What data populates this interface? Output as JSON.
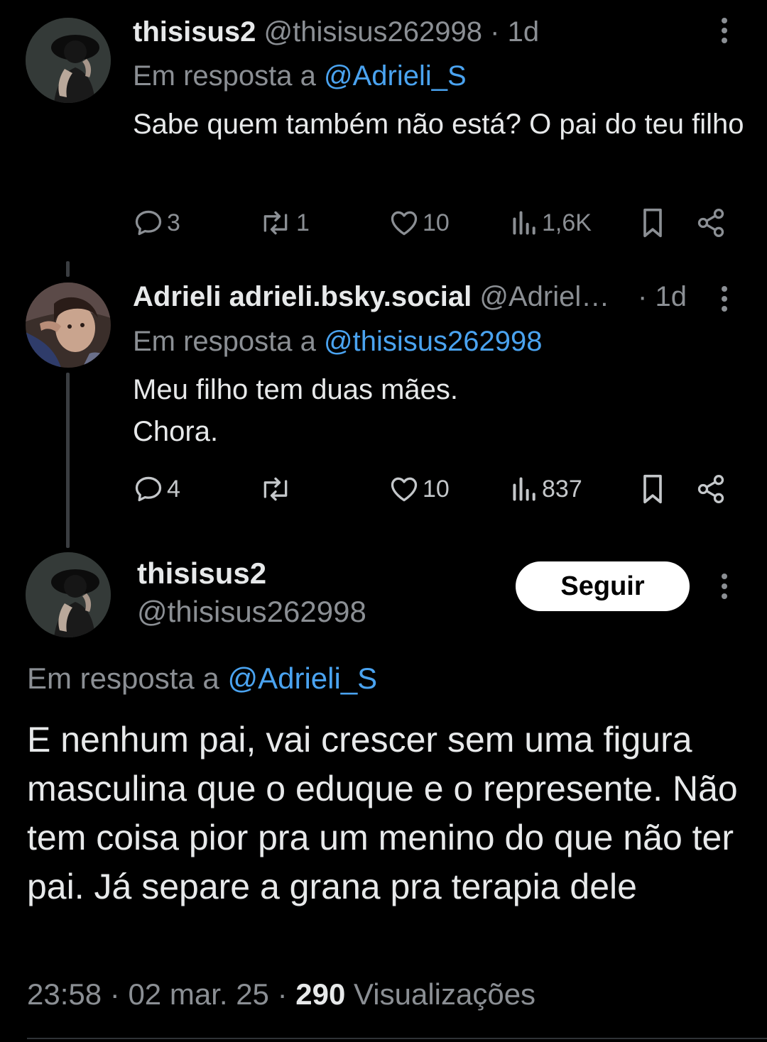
{
  "colors": {
    "background": "#000000",
    "text": "#e7e9ea",
    "muted": "#8b8f94",
    "link": "#4aa3f0",
    "button_bg": "#ffffff"
  },
  "post1": {
    "display_name": "thisisus2",
    "handle": "@thisisus262998",
    "separator": "·",
    "time": "1d",
    "reply_prefix": "Em resposta a",
    "reply_to": "@Adrieli_S",
    "text": "Sabe quem também não está? O pai do teu filho",
    "replies": "3",
    "reposts": "1",
    "likes": "10",
    "views": "1,6K",
    "avatar_icon": "avatar-dark-figure"
  },
  "post2": {
    "display_name": "Adrieli adrieli.bsky.social",
    "handle": "@Adriel…",
    "separator": "·",
    "time": "1d",
    "reply_prefix": "Em resposta a",
    "reply_to": "@thisisus262998",
    "text": "Meu filho tem duas mães.\nChora.",
    "replies": "4",
    "likes": "10",
    "views": "837",
    "avatar_icon": "avatar-woman-portrait"
  },
  "main_post": {
    "display_name": "thisisus2",
    "handle": "@thisisus262998",
    "follow_label": "Seguir",
    "reply_prefix": "Em resposta a",
    "reply_to": "@Adrieli_S",
    "text": "E nenhum pai, vai crescer sem uma figura masculina que o eduque e o represente. Não tem coisa pior pra um menino do que não ter pai. Já separe a grana pra terapia dele",
    "time": "23:58",
    "sep1": "·",
    "date": "02 mar. 25",
    "sep2": "·",
    "views_count": "290",
    "views_label": "Visualizações"
  },
  "icons": [
    "reply-icon",
    "repost-icon",
    "like-icon",
    "views-icon",
    "bookmark-icon",
    "share-icon",
    "more-icon"
  ]
}
